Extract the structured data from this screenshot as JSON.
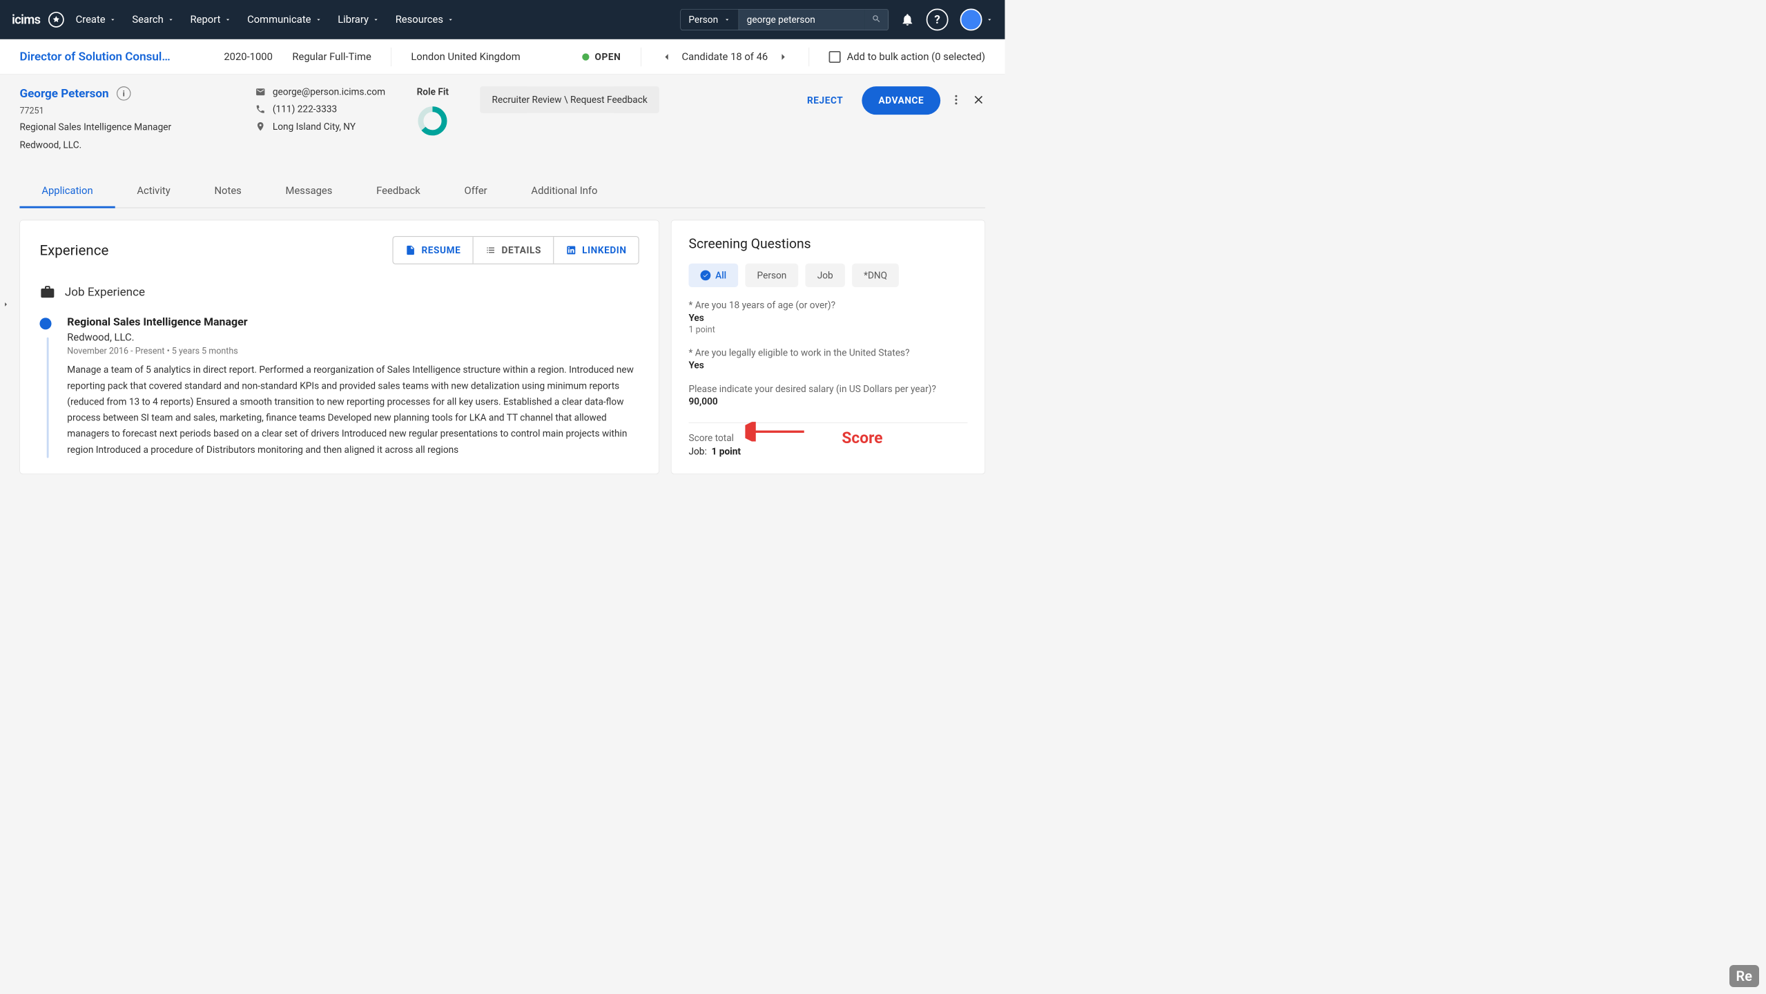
{
  "topnav": {
    "logo": "icims",
    "items": [
      "Create",
      "Search",
      "Report",
      "Communicate",
      "Library",
      "Resources"
    ],
    "search_category": "Person",
    "search_value": "george peterson"
  },
  "subbar": {
    "job_title": "Director of Solution Consul…",
    "job_id": "2020-1000",
    "schedule": "Regular Full-Time",
    "location": "London United Kingdom",
    "status": "OPEN",
    "candidate_count": "Candidate 18 of 46",
    "bulk_label": "Add to bulk action (0 selected)"
  },
  "person": {
    "name": "George Peterson",
    "id": "77251",
    "role": "Regional Sales Intelligence Manager",
    "company": "Redwood, LLC.",
    "email": "george@person.icims.com",
    "phone": "(111) 222-3333",
    "city": "Long Island City, NY",
    "rolefit_label": "Role Fit",
    "review_text": "Recruiter Review \\ Request Feedback",
    "reject": "REJECT",
    "advance": "ADVANCE"
  },
  "tabs": [
    "Application",
    "Activity",
    "Notes",
    "Messages",
    "Feedback",
    "Offer",
    "Additional Info"
  ],
  "experience": {
    "title": "Experience",
    "section": "Job Experience",
    "btns": {
      "resume": "RESUME",
      "details": "DETAILS",
      "linkedin": "LINKEDIN"
    },
    "jobs": [
      {
        "role": "Regional Sales Intelligence Manager",
        "company": "Redwood, LLC.",
        "dates": "November 2016 - Present • 5 years 5 months",
        "body": "Manage a team of 5 analytics in direct report. Performed a reorganization of Sales Intelligence structure within a region. Introduced new reporting pack that covered standard and non-standard KPIs and provided sales teams with new detalization using minimum reports (reduced from 13 to 4 reports) Ensured a smooth transition to new reporting processes for all key users. Established a clear data-flow process between SI team and sales, marketing, finance teams Developed new planning tools for LKA and TT channel that allowed managers to forecast next periods based on a clear set of drivers Introduced new regular presentations to control main projects within region Introduced a procedure of Distributors monitoring and then aligned it across all regions"
      }
    ]
  },
  "screening": {
    "title": "Screening Questions",
    "filters": [
      "All",
      "Person",
      "Job",
      "*DNQ"
    ],
    "questions": [
      {
        "q": "* Are you 18 years of age (or over)?",
        "a": "Yes",
        "pts": "1 point"
      },
      {
        "q": "* Are you legally eligible to work in the United States?",
        "a": "Yes",
        "pts": ""
      },
      {
        "q": "Please indicate your desired salary (in US Dollars per year)?",
        "a": "90,000",
        "pts": ""
      }
    ],
    "score_label": "Score total",
    "score_row": "Job:",
    "score_value": "1 point",
    "callout": "Score"
  },
  "badge": "Re"
}
